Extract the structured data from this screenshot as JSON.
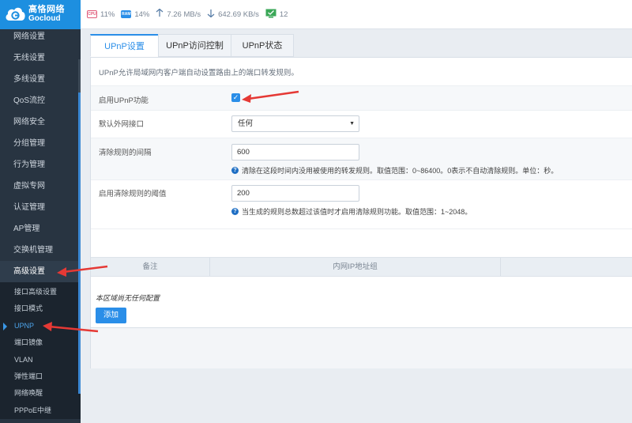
{
  "brand": {
    "name_cn": "高恪网络",
    "name_en": "Gocloud"
  },
  "status": {
    "cpu": {
      "icon": "cpu-icon",
      "value": "11%"
    },
    "ram": {
      "icon": "ram-icon",
      "value": "14%"
    },
    "upload": {
      "icon": "upload-arrow-icon",
      "value": "7.26 MB/s"
    },
    "download": {
      "icon": "download-arrow-icon",
      "value": "642.69 KB/s"
    },
    "clients": {
      "icon": "monitor-check-icon",
      "value": "12"
    }
  },
  "sidebar": {
    "items": [
      {
        "label": "网络设置"
      },
      {
        "label": "无线设置"
      },
      {
        "label": "多线设置"
      },
      {
        "label": "QoS流控"
      },
      {
        "label": "网络安全"
      },
      {
        "label": "分组管理"
      },
      {
        "label": "行为管理"
      },
      {
        "label": "虚拟专网"
      },
      {
        "label": "认证管理"
      },
      {
        "label": "AP管理"
      },
      {
        "label": "交换机管理"
      },
      {
        "label": "高级设置"
      }
    ],
    "subitems": [
      {
        "label": "接口高级设置"
      },
      {
        "label": "接口模式"
      },
      {
        "label": "UPNP"
      },
      {
        "label": "端口镜像"
      },
      {
        "label": "VLAN"
      },
      {
        "label": "弹性端口"
      },
      {
        "label": "网络唤醒"
      },
      {
        "label": "PPPoE中继"
      }
    ]
  },
  "tabs": [
    {
      "label": "UPnP设置"
    },
    {
      "label": "UPnP访问控制"
    },
    {
      "label": "UPnP状态"
    }
  ],
  "form": {
    "description": "UPnP允许局域网内客户端自动设置路由上的端口转发规则。",
    "enable_label": "启用UPnP功能",
    "enable_checked": true,
    "interface_label": "默认外网接口",
    "interface_value": "任何",
    "clear_interval_label": "清除规则的间隔",
    "clear_interval_value": "600",
    "clear_interval_help": "清除在这段时间内没用被使用的转发规则。取值范围：0~86400。0表示不自动清除规则。单位：秒。",
    "clear_threshold_label": "启用清除规则的阈值",
    "clear_threshold_value": "200",
    "clear_threshold_help": "当生成的规则总数超过该值时才启用清除规则功能。取值范围：1~2048。"
  },
  "table": {
    "columns": [
      "备注",
      "内网IP地址组"
    ],
    "empty_text": "本区域尚无任何配置",
    "add_label": "添加"
  },
  "colors": {
    "accent": "#2a8ee8",
    "sidebar": "#283441",
    "annotation": "#e53935"
  }
}
